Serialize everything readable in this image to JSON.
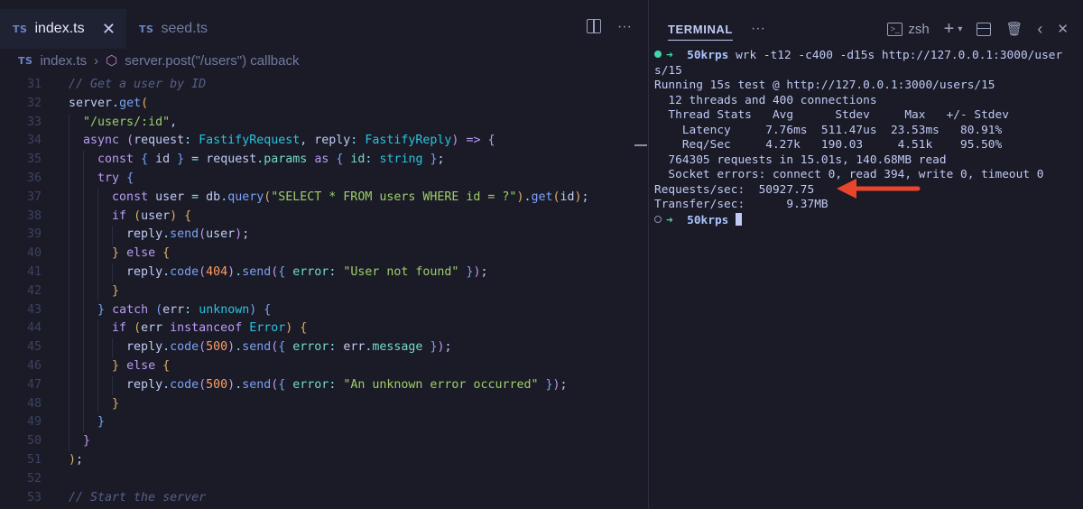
{
  "editor": {
    "tabs": [
      {
        "badge": "TS",
        "label": "index.ts",
        "close": "✕",
        "active": true
      },
      {
        "badge": "TS",
        "label": "seed.ts",
        "active": false
      }
    ],
    "more": "···",
    "breadcrumb": {
      "badge": "TS",
      "file": "index.ts",
      "separator": "›",
      "symbol": "server.post(\"/users\") callback"
    },
    "line_numbers": [
      "31",
      "32",
      "33",
      "34",
      "35",
      "36",
      "37",
      "38",
      "39",
      "40",
      "41",
      "42",
      "43",
      "44",
      "45",
      "46",
      "47",
      "48",
      "49",
      "50",
      "51",
      "52",
      "53"
    ]
  },
  "terminal": {
    "title": "TERMINAL",
    "more": "···",
    "shell": "zsh",
    "lines": [
      {
        "kind": "prompt",
        "dir": "50krps",
        "cmd": " wrk -t12 -c400 -d15s http://127.0.0.1:3000/user"
      },
      {
        "kind": "text",
        "text": "s/15"
      },
      {
        "kind": "text",
        "text": "Running 15s test @ http://127.0.0.1:3000/users/15"
      },
      {
        "kind": "text",
        "text": "  12 threads and 400 connections"
      },
      {
        "kind": "text",
        "text": "  Thread Stats   Avg      Stdev     Max   +/- Stdev"
      },
      {
        "kind": "text",
        "text": "    Latency     7.76ms  511.47us  23.53ms   80.91%"
      },
      {
        "kind": "text",
        "text": "    Req/Sec     4.27k   190.03     4.51k    95.50%"
      },
      {
        "kind": "text",
        "text": "  764305 requests in 15.01s, 140.68MB read"
      },
      {
        "kind": "text",
        "text": "  Socket errors: connect 0, read 394, write 0, timeout 0"
      },
      {
        "kind": "text",
        "text": "Requests/sec:  50927.75"
      },
      {
        "kind": "text",
        "text": "Transfer/sec:      9.37MB"
      },
      {
        "kind": "idle",
        "dir": "50krps"
      }
    ]
  },
  "colors": {
    "background": "#1a1b26",
    "annotation_arrow": "#e8452c",
    "prompt_dot": "#3fd9a8"
  }
}
